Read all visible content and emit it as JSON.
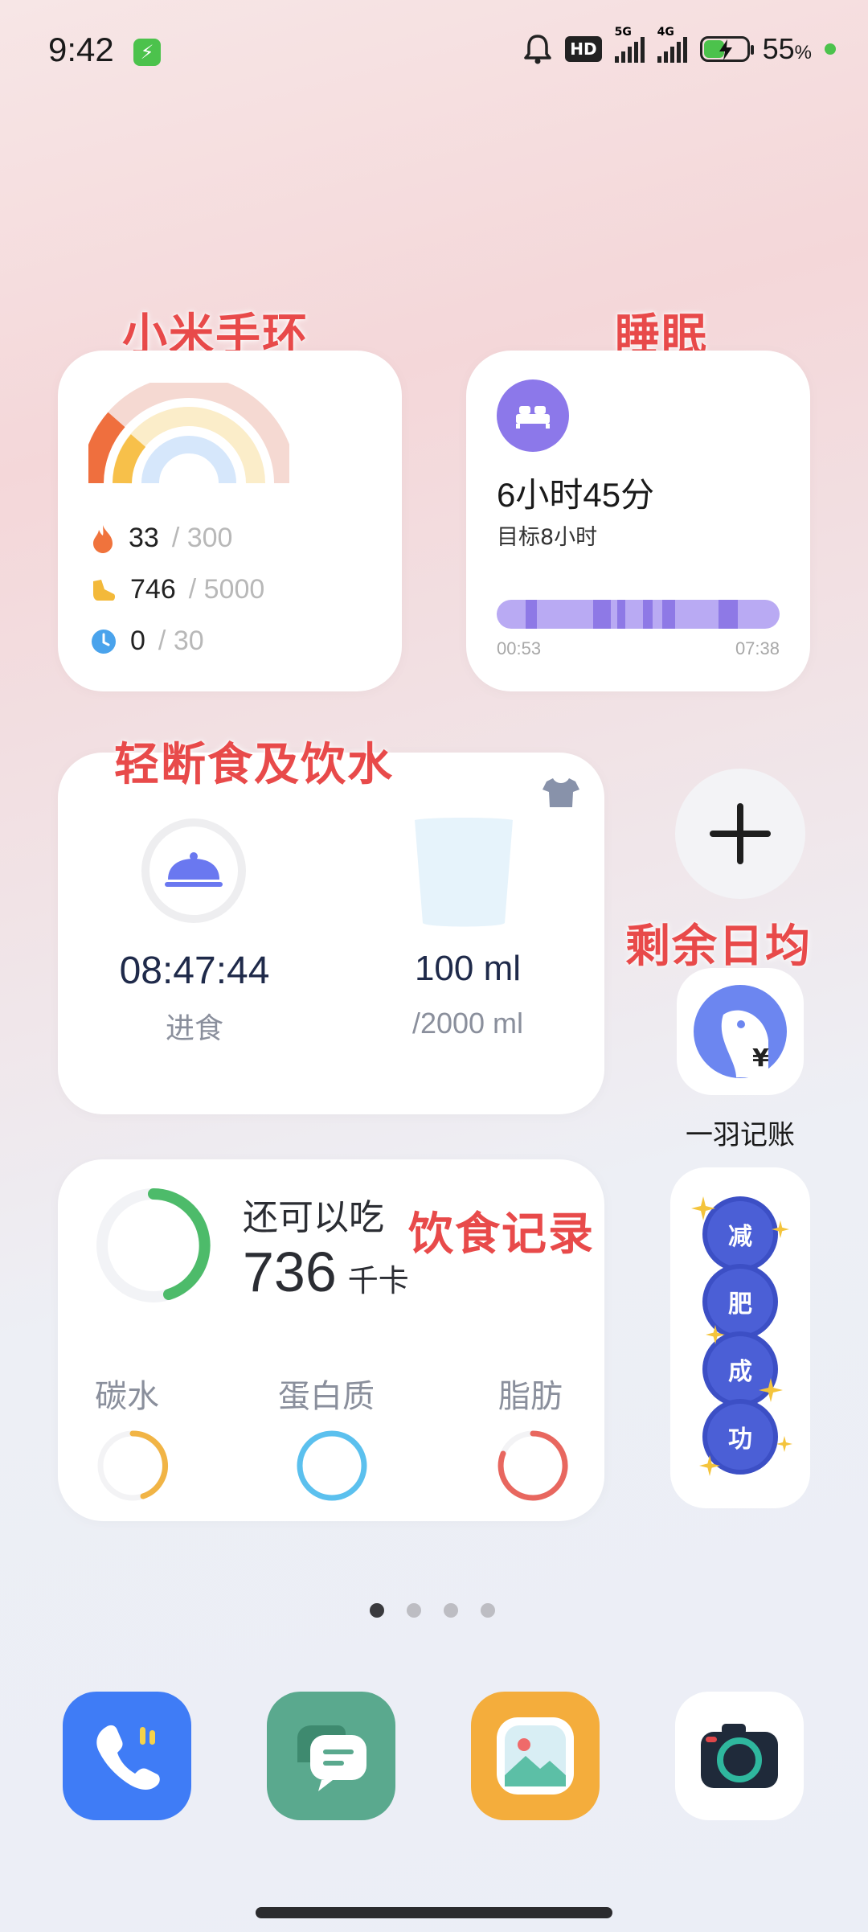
{
  "status_bar": {
    "time": "9:42",
    "network_5g": "5G",
    "network_4g": "4G",
    "hd_label": "HD",
    "battery_percent": "55",
    "percent_sign": "%"
  },
  "annotations": {
    "band": "小米手环",
    "sleep": "睡眠",
    "fasting": "轻断食及饮水",
    "daily": "剩余日均",
    "diet": "饮食记录"
  },
  "band_widget": {
    "calories_value": "33",
    "calories_goal": "/ 300",
    "steps_value": "746",
    "steps_goal": "/ 5000",
    "minutes_value": "0",
    "minutes_goal": "/ 30",
    "icons": [
      "flame-icon",
      "shoe-icon",
      "clock-icon"
    ]
  },
  "sleep_widget": {
    "duration": "6小时45分",
    "goal": "目标8小时",
    "start_time": "00:53",
    "end_time": "07:38",
    "icon": "bed-icon"
  },
  "fasting_widget": {
    "timer": "08:47:44",
    "timer_label": "进食",
    "water_value": "100 ml",
    "water_goal": "/2000 ml",
    "icons": [
      "dome-icon",
      "glass-icon",
      "shirt-icon"
    ]
  },
  "add_button": {
    "icon": "plus-icon"
  },
  "ledger_app": {
    "label": "一羽记账",
    "icon": "bird-yen-icon"
  },
  "weight_loss_widget": {
    "chars": [
      "减",
      "肥",
      "成",
      "功"
    ]
  },
  "diet_widget": {
    "remaining_label": "还可以吃",
    "remaining_value": "736",
    "unit": "千卡",
    "carbs_label": "碳水",
    "protein_label": "蛋白质",
    "fat_label": "脂肪"
  },
  "page_indicator": {
    "count": 4,
    "active": 1
  },
  "dock": {
    "apps": [
      "phone-icon",
      "messages-icon",
      "gallery-icon",
      "camera-icon"
    ]
  },
  "colors": {
    "annotation": "#e84a4a",
    "sleep_purple": "#8b78ea",
    "diet_green": "#4dbb6a",
    "carbs_yellow": "#f1b445",
    "protein_blue": "#5bc0ee",
    "fat_red": "#e8675f"
  }
}
